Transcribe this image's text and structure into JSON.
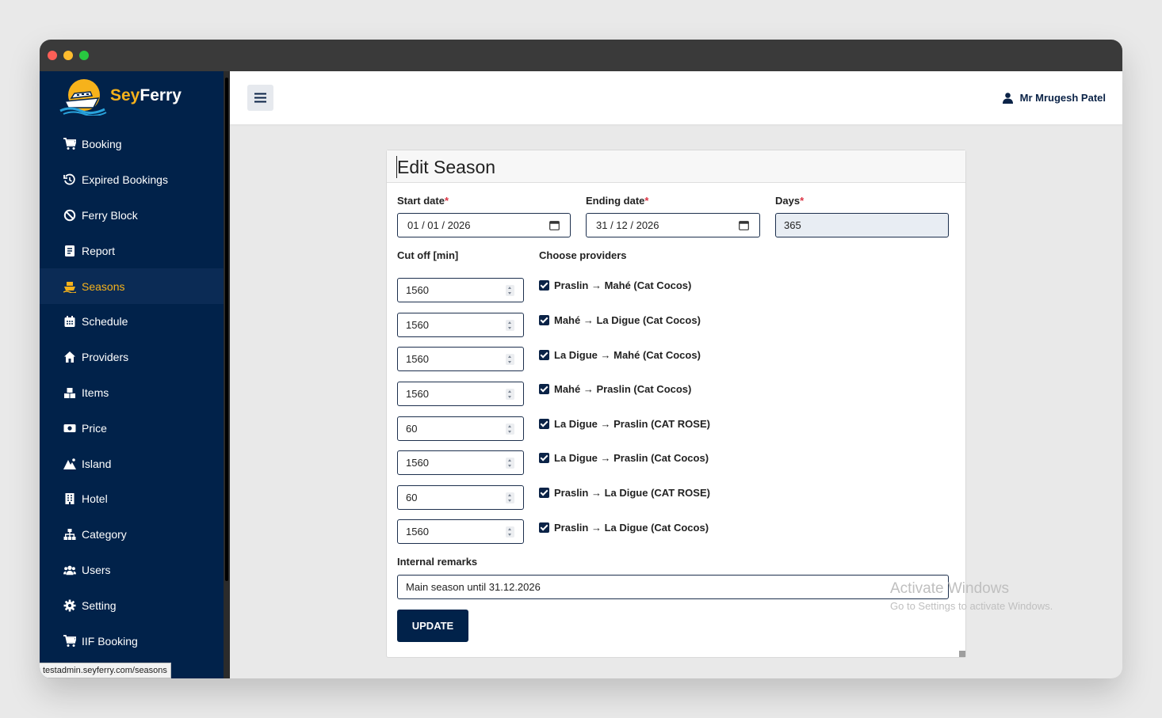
{
  "brand": {
    "name_part1": "Sey",
    "name_part2": "Ferry"
  },
  "sidebar": {
    "items": [
      {
        "label": "Booking",
        "icon": "cart-icon"
      },
      {
        "label": "Expired Bookings",
        "icon": "history-icon"
      },
      {
        "label": "Ferry Block",
        "icon": "ban-icon"
      },
      {
        "label": "Report",
        "icon": "report-icon"
      },
      {
        "label": "Seasons",
        "icon": "ship-icon",
        "active": true
      },
      {
        "label": "Schedule",
        "icon": "calendar-icon"
      },
      {
        "label": "Providers",
        "icon": "home-icon"
      },
      {
        "label": "Items",
        "icon": "boxes-icon"
      },
      {
        "label": "Price",
        "icon": "money-icon"
      },
      {
        "label": "Island",
        "icon": "mountain-icon"
      },
      {
        "label": "Hotel",
        "icon": "building-icon"
      },
      {
        "label": "Category",
        "icon": "sitemap-icon"
      },
      {
        "label": "Users",
        "icon": "users-icon"
      },
      {
        "label": "Setting",
        "icon": "gear-icon"
      },
      {
        "label": "IIF Booking",
        "icon": "cart-icon"
      }
    ]
  },
  "status_url": "testadmin.seyferry.com/seasons",
  "header": {
    "user_name": "Mr Mrugesh Patel"
  },
  "form": {
    "title": "Edit Season",
    "start_date_label": "Start date",
    "start_date_value": "01 / 01 / 2026",
    "end_date_label": "Ending date",
    "end_date_value": "31 / 12 / 2026",
    "days_label": "Days",
    "days_value": "365",
    "required_mark": "*",
    "cutoff_label": "Cut off [min]",
    "providers_label": "Choose providers",
    "providers": [
      {
        "cutoff": "1560",
        "route": "Praslin → Mahé (Cat Cocos)",
        "checked": true
      },
      {
        "cutoff": "1560",
        "route": "Mahé → La Digue (Cat Cocos)",
        "checked": true
      },
      {
        "cutoff": "1560",
        "route": "La Digue → Mahé (Cat Cocos)",
        "checked": true
      },
      {
        "cutoff": "1560",
        "route": "Mahé → Praslin (Cat Cocos)",
        "checked": true
      },
      {
        "cutoff": "60",
        "route": "La Digue → Praslin (CAT ROSE)",
        "checked": true
      },
      {
        "cutoff": "1560",
        "route": "La Digue → Praslin (Cat Cocos)",
        "checked": true
      },
      {
        "cutoff": "60",
        "route": "Praslin → La Digue (CAT ROSE)",
        "checked": true
      },
      {
        "cutoff": "1560",
        "route": "Praslin → La Digue (Cat Cocos)",
        "checked": true
      }
    ],
    "remarks_label": "Internal remarks",
    "remarks_value": "Main season until 31.12.2026",
    "update_label": "UPDATE"
  },
  "watermark": {
    "line1": "Activate Windows",
    "line2": "Go to Settings to activate Windows."
  },
  "colors": {
    "navy": "#01224a",
    "accent": "#f6b21b",
    "required": "#dc3545"
  }
}
